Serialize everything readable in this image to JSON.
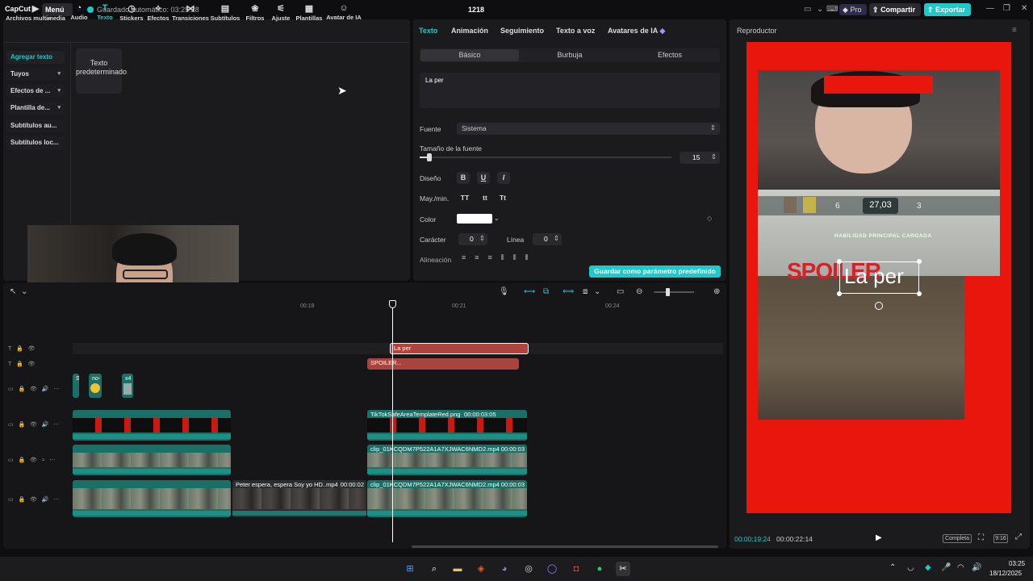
{
  "titlebar": {
    "app_logo": "CapCut",
    "menu_label": "Menú",
    "autosave": "Guardado automático: 03:25:28",
    "project_title": "1218",
    "pro_label": "Pro",
    "share_label": "Compartir",
    "export_label": "Exportar"
  },
  "toolbar": {
    "tabs": [
      {
        "label": "Archivos multimedia",
        "icon": "media-icon"
      },
      {
        "label": "Audio",
        "icon": "audio-icon"
      },
      {
        "label": "Texto",
        "icon": "text-icon"
      },
      {
        "label": "Stickers",
        "icon": "sticker-icon"
      },
      {
        "label": "Efectos",
        "icon": "effects-icon"
      },
      {
        "label": "Transiciones",
        "icon": "transition-icon"
      },
      {
        "label": "Subtítulos",
        "icon": "subtitle-icon"
      },
      {
        "label": "Filtros",
        "icon": "filter-icon"
      },
      {
        "label": "Ajuste",
        "icon": "adjust-icon"
      },
      {
        "label": "Plantillas",
        "icon": "template-icon"
      },
      {
        "label": "Avatar de IA",
        "icon": "ai-avatar-icon"
      }
    ],
    "active_tab": "Texto"
  },
  "sidebar": {
    "items": [
      {
        "label": "Agregar texto"
      },
      {
        "label": "Tuyos"
      },
      {
        "label": "Efectos de ..."
      },
      {
        "label": "Plantilla de..."
      },
      {
        "label": "Subtítulos au..."
      },
      {
        "label": "Subtítulos loc..."
      }
    ]
  },
  "library": {
    "preset_card_label": "Texto predeterminado"
  },
  "inspector": {
    "tabs": [
      {
        "label": "Texto"
      },
      {
        "label": "Animación"
      },
      {
        "label": "Seguimiento"
      },
      {
        "label": "Texto a voz"
      },
      {
        "label": "Avatares de IA"
      }
    ],
    "subtabs": [
      {
        "label": "Básico"
      },
      {
        "label": "Burbuja"
      },
      {
        "label": "Efectos"
      }
    ],
    "text_value": "La per",
    "font_label": "Fuente",
    "font_value": "Sistema",
    "size_label": "Tamaño de la fuente",
    "size_value": "15",
    "size_fraction": 0.04,
    "design_label": "Diseño",
    "design_buttons": [
      "B",
      "U",
      "I"
    ],
    "case_label": "May./min.",
    "case_buttons": [
      "TT",
      "tt",
      "Tt"
    ],
    "color_label": "Color",
    "color_value": "#ffffff",
    "char_label": "Carácter",
    "char_value": "0",
    "line_label": "Línea",
    "line_value": "0",
    "align_label": "Alineación",
    "save_preset_label": "Guardar como parámetro predefinido"
  },
  "player": {
    "title": "Reproductor",
    "overlay_text": "La per",
    "spoiler_text": "SPOILER",
    "hud_score": "27,03",
    "hud_left": "6",
    "hud_right": "3",
    "hud_label": "HABILIDAD PRINCIPAL CARGADA",
    "time_current": "00:00:19:24",
    "time_total": "00:00:22:14",
    "completa_label": "Completa",
    "ratio_label": "9:16",
    "accent_color": "#1fc9c9",
    "canvas_color": "#e8160c"
  },
  "timeline": {
    "ruler": [
      "00:18",
      "00:21",
      "00:24"
    ],
    "clips": {
      "text_clip": "La per",
      "spoiler_clip": "SPOILER...",
      "tiny1": "S",
      "tiny2": "no-",
      "tiny3": "x4",
      "overlay_name": "TikTokSafeAreaTemplateRed.png",
      "overlay_dur": "00:00:03:05",
      "clip_b_name": "clip_01KCQDM7P522A1A7XJWAC6NMD2.mp4",
      "clip_b_dur": "00:00:03",
      "clip_c1_name": "Peter espera, espera Soy yo  HD..mp4",
      "clip_c1_dur": "00:00:02",
      "clip_c2_name": "clip_01KCQDM7P522A1A7XJWAC6NMD2.mp4",
      "clip_c2_dur": "00:00:03"
    }
  },
  "taskbar": {
    "time": "03:25",
    "date": "18/12/2025"
  }
}
